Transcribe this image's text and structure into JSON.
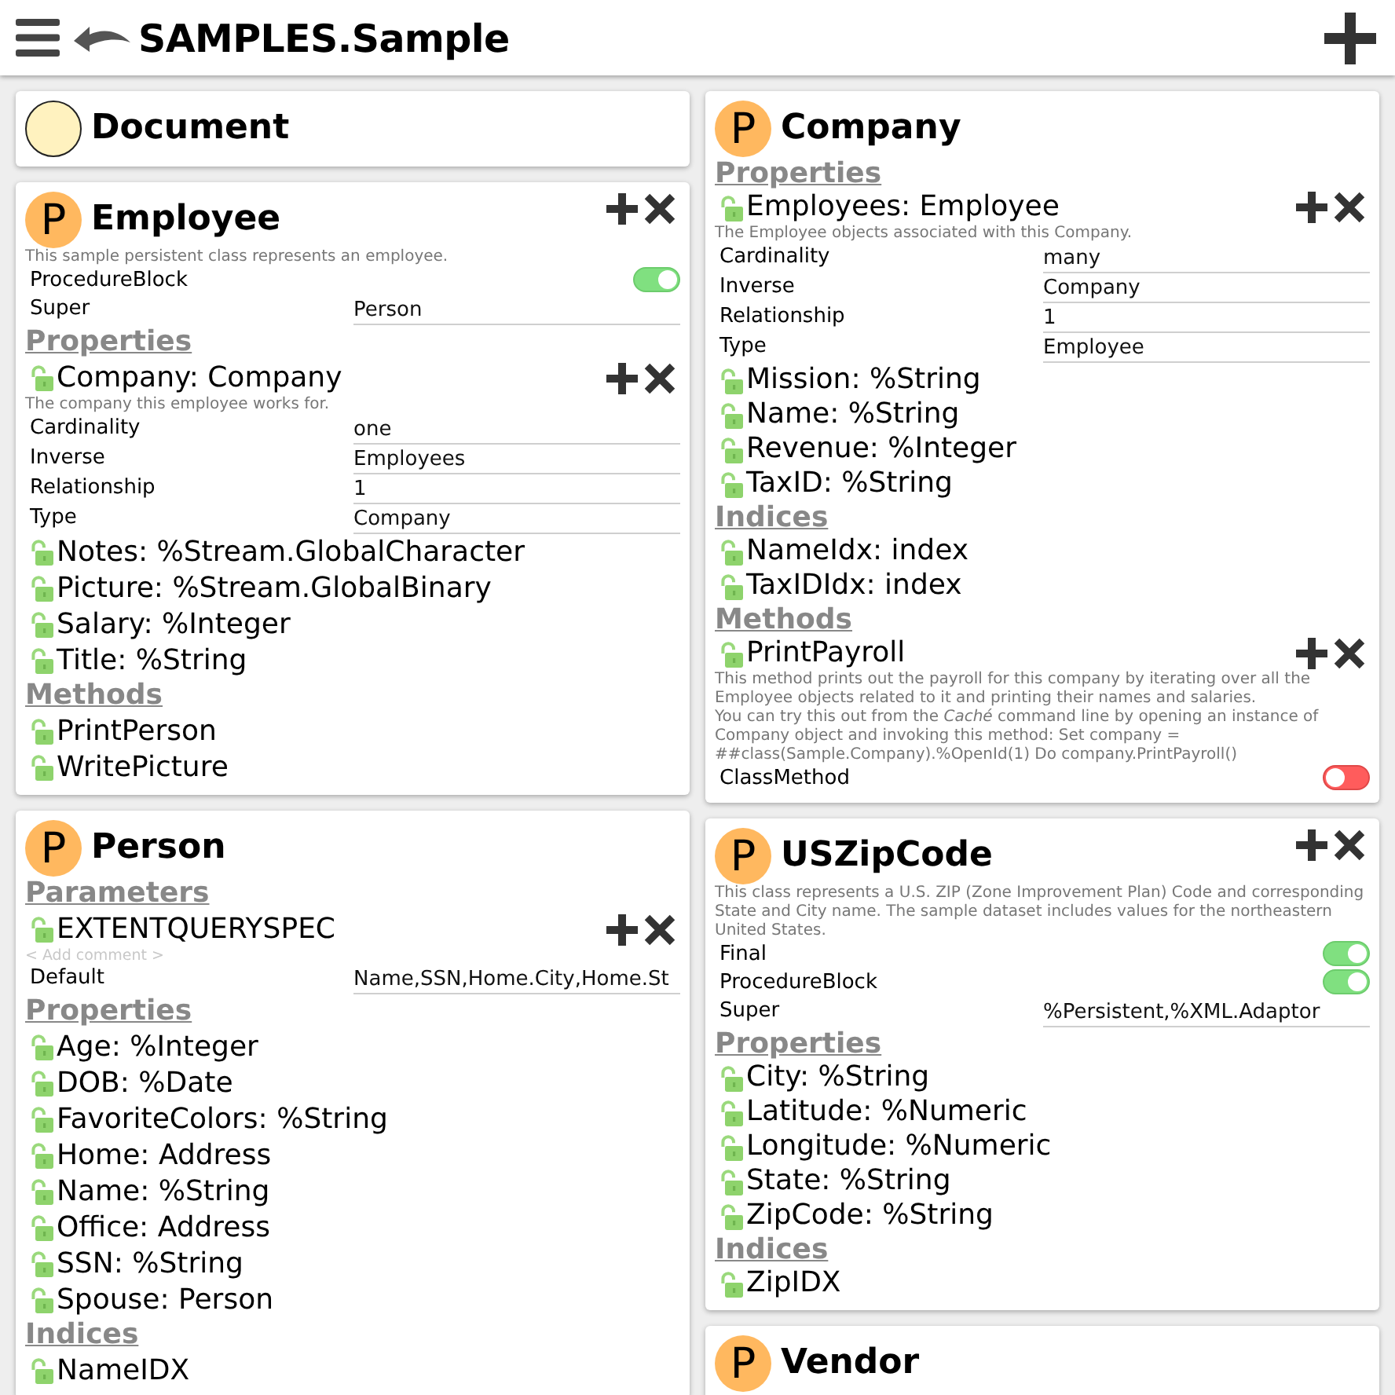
{
  "header": {
    "title": "SAMPLES.Sample"
  },
  "columns": [
    [
      {
        "kind": "document",
        "name": "Document",
        "actions_shown": false
      },
      {
        "kind": "class",
        "badge": "P",
        "name": "Employee",
        "actions_shown": true,
        "description": "This sample persistent class represents an employee.",
        "keywords": [
          {
            "kind": "toggle",
            "label": "ProcedureBlock",
            "on": true
          },
          {
            "kind": "text",
            "label": "Super",
            "value": "Person"
          }
        ],
        "sections": [
          {
            "title": "Properties",
            "members": [
              {
                "name": "Company: Company",
                "actions_shown": true,
                "description": "The company this employee works for.",
                "params": [
                  {
                    "kind": "text",
                    "label": "Cardinality",
                    "value": "one"
                  },
                  {
                    "kind": "text",
                    "label": "Inverse",
                    "value": "Employees"
                  },
                  {
                    "kind": "text",
                    "label": "Relationship",
                    "value": "1"
                  },
                  {
                    "kind": "text",
                    "label": "Type",
                    "value": "Company"
                  }
                ]
              },
              {
                "name": "Notes: %Stream.GlobalCharacter",
                "actions_shown": false
              },
              {
                "name": "Picture: %Stream.GlobalBinary",
                "actions_shown": false
              },
              {
                "name": "Salary: %Integer",
                "actions_shown": false
              },
              {
                "name": "Title: %String",
                "actions_shown": false
              }
            ]
          },
          {
            "title": "Methods",
            "members": [
              {
                "name": "PrintPerson",
                "actions_shown": false
              },
              {
                "name": "WritePicture",
                "actions_shown": false
              }
            ]
          }
        ]
      },
      {
        "kind": "class",
        "badge": "P",
        "name": "Person",
        "actions_shown": false,
        "sections": [
          {
            "title": "Parameters",
            "members": [
              {
                "name": "EXTENTQUERYSPEC",
                "actions_shown": true,
                "comment_placeholder": "< Add comment >",
                "params": [
                  {
                    "kind": "text",
                    "label": "Default",
                    "value": "Name,SSN,Home.City,Home.St"
                  }
                ]
              }
            ]
          },
          {
            "title": "Properties",
            "members": [
              {
                "name": "Age: %Integer",
                "actions_shown": false
              },
              {
                "name": "DOB: %Date",
                "actions_shown": false
              },
              {
                "name": "FavoriteColors: %String",
                "actions_shown": false
              },
              {
                "name": "Home: Address",
                "actions_shown": false
              },
              {
                "name": "Name: %String",
                "actions_shown": false
              },
              {
                "name": "Office: Address",
                "actions_shown": false
              },
              {
                "name": "SSN: %String",
                "actions_shown": false
              },
              {
                "name": "Spouse: Person",
                "actions_shown": false
              }
            ]
          },
          {
            "title": "Indices",
            "members": [
              {
                "name": "NameIDX",
                "actions_shown": false
              }
            ]
          }
        ]
      }
    ],
    [
      {
        "kind": "class",
        "badge": "P",
        "name": "Company",
        "actions_shown": false,
        "sections": [
          {
            "title": "Properties",
            "members": [
              {
                "name": "Employees: Employee",
                "actions_shown": true,
                "description": "The Employee objects associated with this Company.",
                "params": [
                  {
                    "kind": "text",
                    "label": "Cardinality",
                    "value": "many"
                  },
                  {
                    "kind": "text",
                    "label": "Inverse",
                    "value": "Company"
                  },
                  {
                    "kind": "text",
                    "label": "Relationship",
                    "value": "1"
                  },
                  {
                    "kind": "text",
                    "label": "Type",
                    "value": "Employee"
                  }
                ]
              },
              {
                "name": "Mission: %String",
                "actions_shown": false
              },
              {
                "name": "Name: %String",
                "actions_shown": false
              },
              {
                "name": "Revenue: %Integer",
                "actions_shown": false
              },
              {
                "name": "TaxID: %String",
                "actions_shown": false
              }
            ]
          },
          {
            "title": "Indices",
            "members": [
              {
                "name": "NameIdx: index",
                "actions_shown": false
              },
              {
                "name": "TaxIDIdx: index",
                "actions_shown": false
              }
            ]
          },
          {
            "title": "Methods",
            "members": [
              {
                "name": "PrintPayroll",
                "actions_shown": true,
                "description": "This method prints out the payroll for this company by iterating over all the Employee objects related to it and printing their names and salaries.\nYou can try this out from the *Caché* command line by opening an instance of Company object and invoking this method: Set company = ##class(Sample.Company).%OpenId(1) Do company.PrintPayroll()",
                "params": [
                  {
                    "kind": "toggle",
                    "label": "ClassMethod",
                    "on": false
                  }
                ]
              }
            ]
          }
        ]
      },
      {
        "kind": "class",
        "badge": "P",
        "name": "USZipCode",
        "actions_shown": true,
        "description": "This class represents a U.S. ZIP (Zone Improvement Plan) Code and corresponding State and City name. The sample dataset includes values for the northeastern United States.",
        "keywords": [
          {
            "kind": "toggle",
            "label": "Final",
            "on": true
          },
          {
            "kind": "toggle",
            "label": "ProcedureBlock",
            "on": true
          },
          {
            "kind": "text",
            "label": "Super",
            "value": "%Persistent,%XML.Adaptor"
          }
        ],
        "sections": [
          {
            "title": "Properties",
            "members": [
              {
                "name": "City: %String",
                "actions_shown": false
              },
              {
                "name": "Latitude: %Numeric",
                "actions_shown": false
              },
              {
                "name": "Longitude: %Numeric",
                "actions_shown": false
              },
              {
                "name": "State: %String",
                "actions_shown": false
              },
              {
                "name": "ZipCode: %String",
                "actions_shown": false
              }
            ]
          },
          {
            "title": "Indices",
            "members": [
              {
                "name": "ZipIDX",
                "actions_shown": false
              }
            ]
          }
        ]
      },
      {
        "kind": "class",
        "badge": "P",
        "name": "Vendor",
        "actions_shown": false
      }
    ]
  ]
}
